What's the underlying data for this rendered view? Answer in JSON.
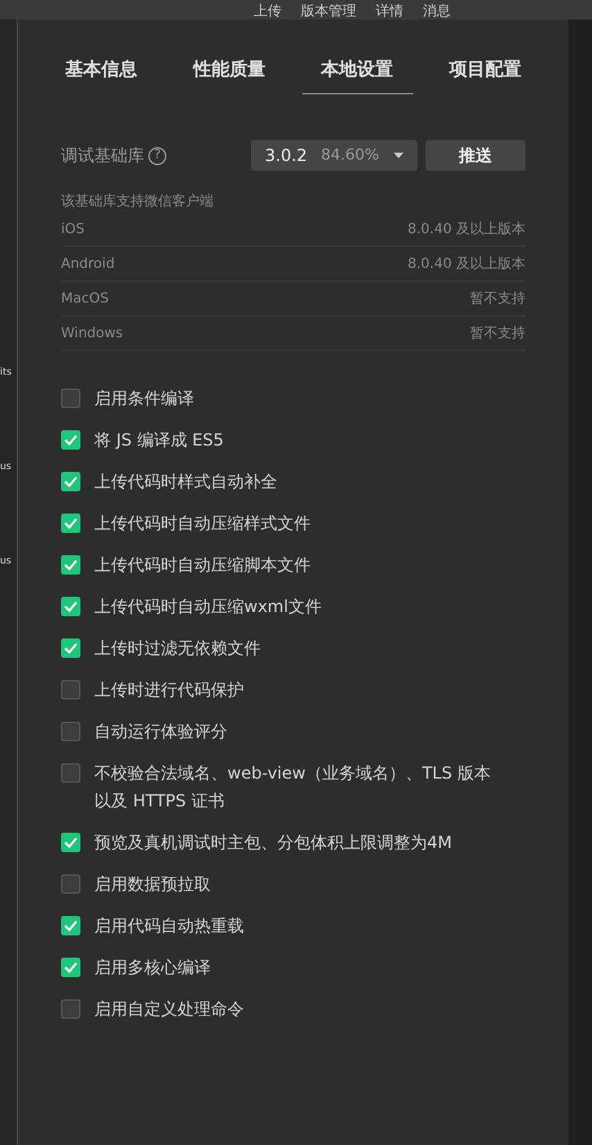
{
  "top_bar": [
    "上传",
    "版本管理",
    "详情",
    "消息"
  ],
  "left_fragments": [
    "its",
    "us",
    "us"
  ],
  "tabs": [
    {
      "label": "基本信息",
      "selected": false
    },
    {
      "label": "性能质量",
      "selected": false
    },
    {
      "label": "本地设置",
      "selected": true
    },
    {
      "label": "项目配置",
      "selected": false
    }
  ],
  "base_library": {
    "label": "调试基础库",
    "help": "?",
    "version": "3.0.2",
    "share": "84.60%",
    "push_button": "推送"
  },
  "support": {
    "caption": "该基础库支持微信客户端",
    "rows": [
      {
        "platform": "iOS",
        "value": "8.0.40 及以上版本"
      },
      {
        "platform": "Android",
        "value": "8.0.40 及以上版本"
      },
      {
        "platform": "MacOS",
        "value": "暂不支持"
      },
      {
        "platform": "Windows",
        "value": "暂不支持"
      }
    ]
  },
  "options": [
    {
      "label": "启用条件编译",
      "checked": false
    },
    {
      "label": "将 JS 编译成 ES5",
      "checked": true
    },
    {
      "label": "上传代码时样式自动补全",
      "checked": true
    },
    {
      "label": "上传代码时自动压缩样式文件",
      "checked": true
    },
    {
      "label": "上传代码时自动压缩脚本文件",
      "checked": true
    },
    {
      "label": "上传代码时自动压缩wxml文件",
      "checked": true
    },
    {
      "label": "上传时过滤无依赖文件",
      "checked": true
    },
    {
      "label": "上传时进行代码保护",
      "checked": false
    },
    {
      "label": "自动运行体验评分",
      "checked": false
    },
    {
      "label": "不校验合法域名、web-view（业务域名）、TLS 版本以及 HTTPS 证书",
      "checked": false
    },
    {
      "label": "预览及真机调试时主包、分包体积上限调整为4M",
      "checked": true
    },
    {
      "label": "启用数据预拉取",
      "checked": false
    },
    {
      "label": "启用代码自动热重载",
      "checked": true
    },
    {
      "label": "启用多核心编译",
      "checked": true
    },
    {
      "label": "启用自定义处理命令",
      "checked": false
    }
  ]
}
